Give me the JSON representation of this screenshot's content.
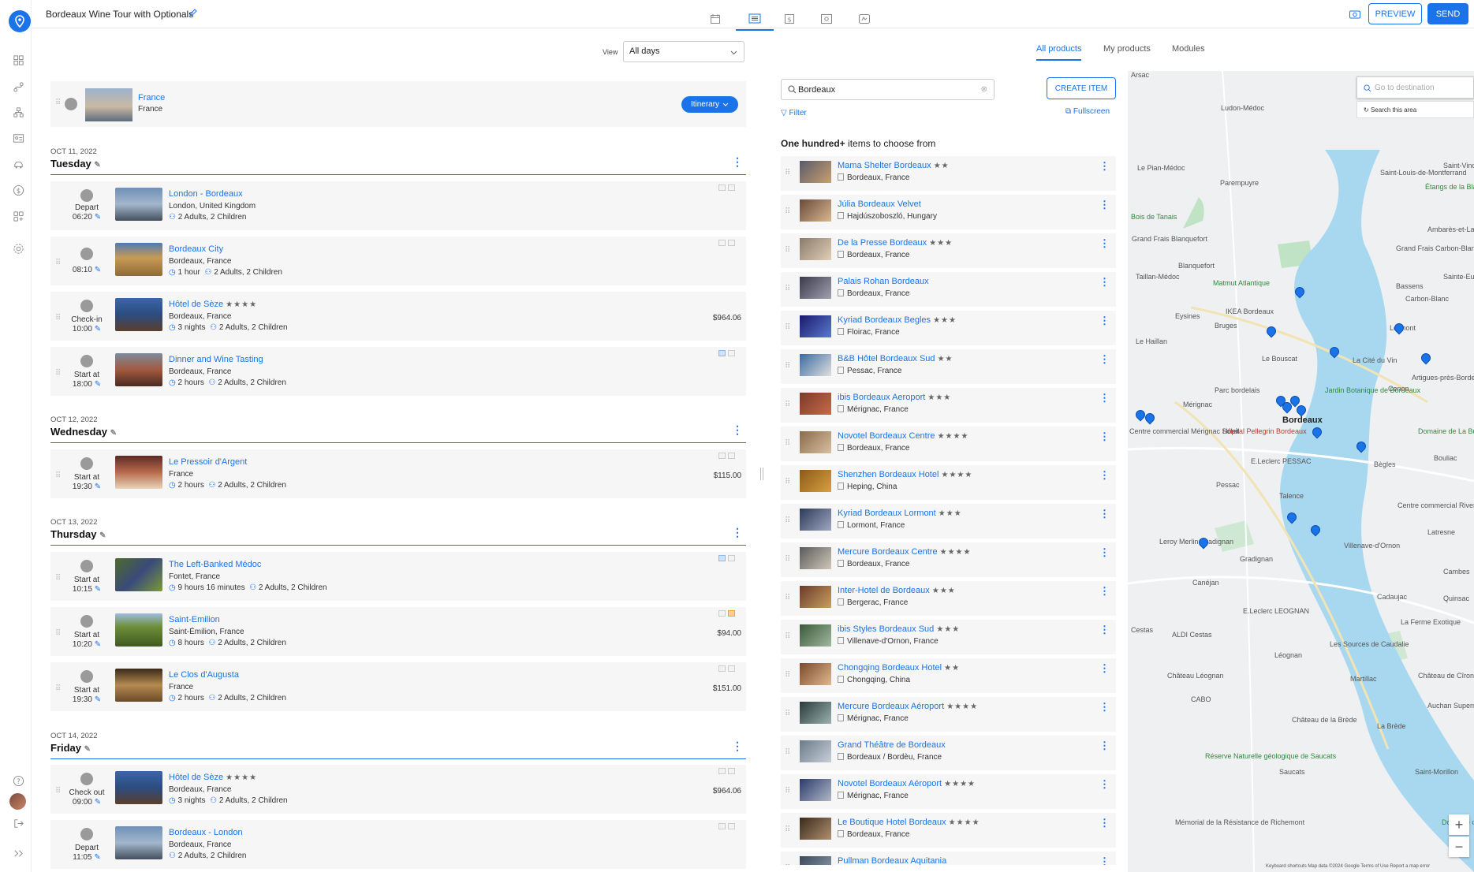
{
  "header": {
    "trip_title": "Bordeaux Wine Tour with Optionals",
    "preview_label": "PREVIEW",
    "send_label": "SEND",
    "tabs": [
      "calendar-icon",
      "list-icon",
      "dollar-icon",
      "settings-card-icon",
      "map-card-icon"
    ]
  },
  "sidebar": {
    "icons": [
      "dashboard-icon",
      "route-icon",
      "hierarchy-icon",
      "contact-card-icon",
      "cars-icon",
      "currency-icon",
      "apps-icon",
      "settings-icon",
      "help-icon",
      "avatar",
      "logout-icon",
      "expand-icon"
    ]
  },
  "itinerary": {
    "view_label": "View",
    "view_value": "All days",
    "destination": {
      "title": "France",
      "subtitle": "France",
      "button": "Itinerary"
    },
    "days": [
      {
        "date": "OCT 11, 2022",
        "name": "Tuesday",
        "items": [
          {
            "title": "London - Bordeaux",
            "location": "London, United Kingdom",
            "duration": "",
            "guests": "2 Adults, 2 Children",
            "label": "Depart",
            "time": "06:20",
            "price": "",
            "stars": ""
          },
          {
            "title": "Bordeaux City",
            "location": "Bordeaux, France",
            "duration": "1 hour",
            "guests": "2 Adults, 2 Children",
            "label": "",
            "time": "08:10",
            "price": "",
            "stars": ""
          },
          {
            "title": "Hôtel de Sèze",
            "location": "Bordeaux, France",
            "duration": "3 nights",
            "guests": "2 Adults, 2 Children",
            "label": "Check-in",
            "time": "10:00",
            "price": "$964.06",
            "stars": "★★★★"
          },
          {
            "title": "Dinner and Wine Tasting",
            "location": "Bordeaux, France",
            "duration": "2 hours",
            "guests": "2 Adults, 2 Children",
            "label": "Start at",
            "time": "18:00",
            "price": "",
            "stars": ""
          }
        ]
      },
      {
        "date": "OCT 12, 2022",
        "name": "Wednesday",
        "items": [
          {
            "title": "Le Pressoir d'Argent",
            "location": "France",
            "duration": "2 hours",
            "guests": "2 Adults, 2 Children",
            "label": "Start at",
            "time": "19:30",
            "price": "$115.00",
            "stars": ""
          }
        ]
      },
      {
        "date": "OCT 13, 2022",
        "name": "Thursday",
        "items": [
          {
            "title": "The Left-Banked Médoc",
            "location": "Fontet, France",
            "duration": "9 hours 16 minutes",
            "guests": "2 Adults, 2 Children",
            "label": "Start at",
            "time": "10:15",
            "price": "",
            "stars": ""
          },
          {
            "title": "Saint-Emilion",
            "location": "Saint-Émilion, France",
            "duration": "8 hours",
            "guests": "2 Adults, 2 Children",
            "label": "Start at",
            "time": "10:20",
            "price": "$94.00",
            "stars": ""
          },
          {
            "title": "Le Clos d'Augusta",
            "location": "France",
            "duration": "2 hours",
            "guests": "2 Adults, 2 Children",
            "label": "Start at",
            "time": "19:30",
            "price": "$151.00",
            "stars": ""
          }
        ]
      },
      {
        "date": "OCT 14, 2022",
        "name": "Friday",
        "items": [
          {
            "title": "Hôtel de Sèze",
            "location": "Bordeaux, France",
            "duration": "3 nights",
            "guests": "2 Adults, 2 Children",
            "label": "Check out",
            "time": "09:00",
            "price": "$964.06",
            "stars": "★★★★"
          },
          {
            "title": "Bordeaux - London",
            "location": "Bordeaux, France",
            "duration": "",
            "guests": "2 Adults, 2 Children",
            "label": "Depart",
            "time": "11:05",
            "price": "",
            "stars": ""
          }
        ]
      }
    ]
  },
  "products": {
    "tabs": [
      "All products",
      "My products",
      "Modules"
    ],
    "search_value": "Bordeaux",
    "create_label": "CREATE ITEM",
    "filter_label": "Filter",
    "fullscreen_label": "Fullscreen",
    "count_bold": "One hundred+",
    "count_rest": "items to choose from",
    "items": [
      {
        "name": "Mama Shelter Bordeaux",
        "stars": "★★",
        "location": "Bordeaux, France"
      },
      {
        "name": "Júlia Bordeaux Velvet",
        "stars": "",
        "location": "Hajdúszoboszló, Hungary"
      },
      {
        "name": "De la Presse Bordeaux",
        "stars": "★★★",
        "location": "Bordeaux, France"
      },
      {
        "name": "Palais Rohan Bordeaux",
        "stars": "",
        "location": "Bordeaux, France"
      },
      {
        "name": "Kyriad Bordeaux Begles",
        "stars": "★★★",
        "location": "Floirac, France"
      },
      {
        "name": "B&B Hôtel Bordeaux Sud",
        "stars": "★★",
        "location": "Pessac, France"
      },
      {
        "name": "ibis Bordeaux Aeroport",
        "stars": "★★★",
        "location": "Mérignac, France"
      },
      {
        "name": "Novotel Bordeaux Centre",
        "stars": "★★★★",
        "location": "Bordeaux, France"
      },
      {
        "name": "Shenzhen Bordeaux Hotel",
        "stars": "★★★★",
        "location": "Heping, China"
      },
      {
        "name": "Kyriad Bordeaux Lormont",
        "stars": "★★★",
        "location": "Lormont, France"
      },
      {
        "name": "Mercure Bordeaux Centre",
        "stars": "★★★★",
        "location": "Bordeaux, France"
      },
      {
        "name": "Inter-Hotel de Bordeaux",
        "stars": "★★★",
        "location": "Bergerac, France"
      },
      {
        "name": "ibis Styles Bordeaux Sud",
        "stars": "★★★",
        "location": "Villenave-d'Ornon, France"
      },
      {
        "name": "Chongqing Bordeaux Hotel",
        "stars": "★★",
        "location": "Chongqing, China"
      },
      {
        "name": "Mercure Bordeaux Aéroport",
        "stars": "★★★★",
        "location": "Mérignac, France"
      },
      {
        "name": "Grand Théâtre de Bordeaux",
        "stars": "",
        "location": "Bordeaux / Bordèu, France"
      },
      {
        "name": "Novotel Bordeaux Aéroport",
        "stars": "★★★★",
        "location": "Mérignac, France"
      },
      {
        "name": "Le Boutique Hotel Bordeaux",
        "stars": "★★★★",
        "location": "Bordeaux, France"
      },
      {
        "name": "Pullman Bordeaux Aquitania",
        "stars": "",
        "location": ""
      }
    ]
  },
  "map": {
    "search_placeholder": "Go to destination",
    "search_area_label": "Search this area",
    "footer": "Keyboard shortcuts   Map data ©2024 Google   Terms of Use   Report a map error",
    "labels": [
      "Arsac",
      "Ludon-Médoc",
      "Le Pian-Médoc",
      "Parempuyre",
      "Saint-Louis-de-Montferrand",
      "Saint-Vincent",
      "Bois de Tanais",
      "Grand Frais Blanquefort",
      "Blanquefort",
      "Étangs de la Blanche",
      "Ambarès-et-Lagrave",
      "Grand Frais Carbon-Blanc",
      "Taillan-Médoc",
      "Matmut Atlantique",
      "Bassens",
      "Sainte-Eulalie",
      "Carbon-Blanc",
      "Eysines",
      "IKEA Bordeaux",
      "Bruges",
      "Lormont",
      "Le Haillan",
      "Le Bouscat",
      "La Cité du Vin",
      "Artigues-près-Bordeaux",
      "Mérignac",
      "Parc bordelais",
      "Jardin Botanique de Bordeaux",
      "Cenon",
      "Bordeaux",
      "Hôpital Pellegrin Bordeaux",
      "Domaine de La Burthe",
      "Centre commercial Mérignac Soleil",
      "E.Leclerc PESSAC",
      "Pessac",
      "Talence",
      "Bègles",
      "Bouliac",
      "Centre commercial Rives d'Arcins",
      "Latresne",
      "Villenave-d'Ornon",
      "Leroy Merlin Gradignan",
      "Gradignan",
      "Canéjan",
      "Cambes",
      "Cadaujac",
      "Quinsac",
      "E.Leclerc LEOGNAN",
      "Cestas",
      "ALDI Cestas",
      "Les Sources de Caudalie",
      "La Ferme Exotique",
      "Léognan",
      "Château Léognan",
      "Martillac",
      "Château de Cîrons",
      "CABO",
      "Auchan Supermarché",
      "Château de la Brède",
      "La Brède",
      "Saucats",
      "Réserve Naturelle géologique de Saucats",
      "Saint-Morillon",
      "Mémorial de la Résistance de Richemont",
      "Domaine de Lamothe"
    ]
  }
}
